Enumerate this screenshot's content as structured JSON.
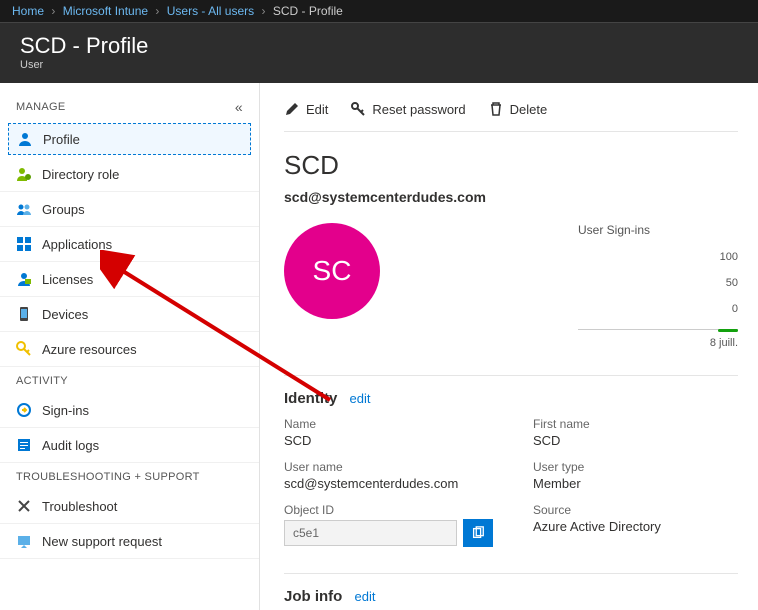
{
  "breadcrumb": {
    "home": "Home",
    "intune": "Microsoft Intune",
    "users": "Users - All users",
    "current": "SCD - Profile"
  },
  "header": {
    "title": "SCD - Profile",
    "sub": "User"
  },
  "sidebar": {
    "manage_label": "MANAGE",
    "activity_label": "ACTIVITY",
    "troubleshoot_label": "TROUBLESHOOTING + SUPPORT",
    "manage": [
      {
        "label": "Profile"
      },
      {
        "label": "Directory role"
      },
      {
        "label": "Groups"
      },
      {
        "label": "Applications"
      },
      {
        "label": "Licenses"
      },
      {
        "label": "Devices"
      },
      {
        "label": "Azure resources"
      }
    ],
    "activity": [
      {
        "label": "Sign-ins"
      },
      {
        "label": "Audit logs"
      }
    ],
    "support": [
      {
        "label": "Troubleshoot"
      },
      {
        "label": "New support request"
      }
    ]
  },
  "toolbar": {
    "edit": "Edit",
    "reset": "Reset password",
    "delete": "Delete"
  },
  "profile": {
    "display_name": "SCD",
    "email": "scd@systemcenterdudes.com",
    "initials": "SC"
  },
  "signins": {
    "label": "User Sign-ins",
    "t100": "100",
    "t50": "50",
    "t0": "0",
    "date": "8 juill."
  },
  "identity": {
    "title": "Identity",
    "edit": "edit",
    "name_lbl": "Name",
    "name_val": "SCD",
    "first_lbl": "First name",
    "first_val": "SCD",
    "user_lbl": "User name",
    "user_val": "scd@systemcenterdudes.com",
    "type_lbl": "User type",
    "type_val": "Member",
    "obj_lbl": "Object ID",
    "obj_val": "c5e1",
    "src_lbl": "Source",
    "src_val": "Azure Active Directory"
  },
  "jobinfo": {
    "title": "Job info",
    "edit": "edit"
  }
}
